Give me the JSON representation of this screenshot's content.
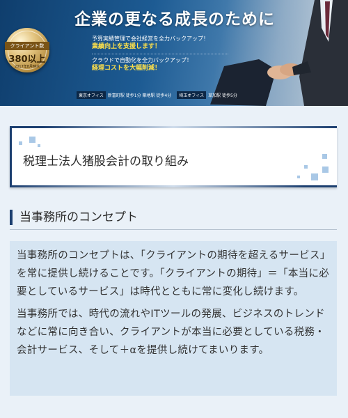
{
  "hero": {
    "headline": "企業の更なる成長のために",
    "badge": {
      "label": "クライアント数",
      "count": "380以上",
      "date": "2017年8月時点"
    },
    "lines": [
      {
        "text": "予算実績管理で会社経営を全力バックアップ！",
        "highlight": "業績向上を支援します！"
      },
      {
        "text": "クラウドで自動化を全力バックアップ！",
        "highlight": "経理コストを大幅削減！"
      }
    ],
    "offices": [
      {
        "name": "東京オフィス",
        "access": "新富町駅 徒歩1分 築地駅 徒歩4分"
      },
      {
        "name": "埼玉オフィス",
        "access": "草加駅 徒歩5分"
      }
    ]
  },
  "page": {
    "title": "税理士法人猪股会計の取り組み"
  },
  "section": {
    "heading": "当事務所のコンセプト",
    "paragraphs": [
      "当事務所のコンセプトは、「クライアントの期待を超えるサービス」を常に提供し続けることです。「クライアントの期待」＝「本当に必要としているサービス」は時代とともに常に変化し続けます。",
      "当事務所では、時代の流れやITツールの発展、ビジネスのトレンドなどに常に向き合い、クライアントが本当に必要としている税務・会計サービス、そして＋αを提供し続けてまいります。"
    ]
  },
  "colors": {
    "accent": "#1c3f70",
    "highlight": "#ffe14a",
    "panel": "#d6e5f2"
  },
  "icons": [
    "gold-medal-icon",
    "handshake-image"
  ]
}
